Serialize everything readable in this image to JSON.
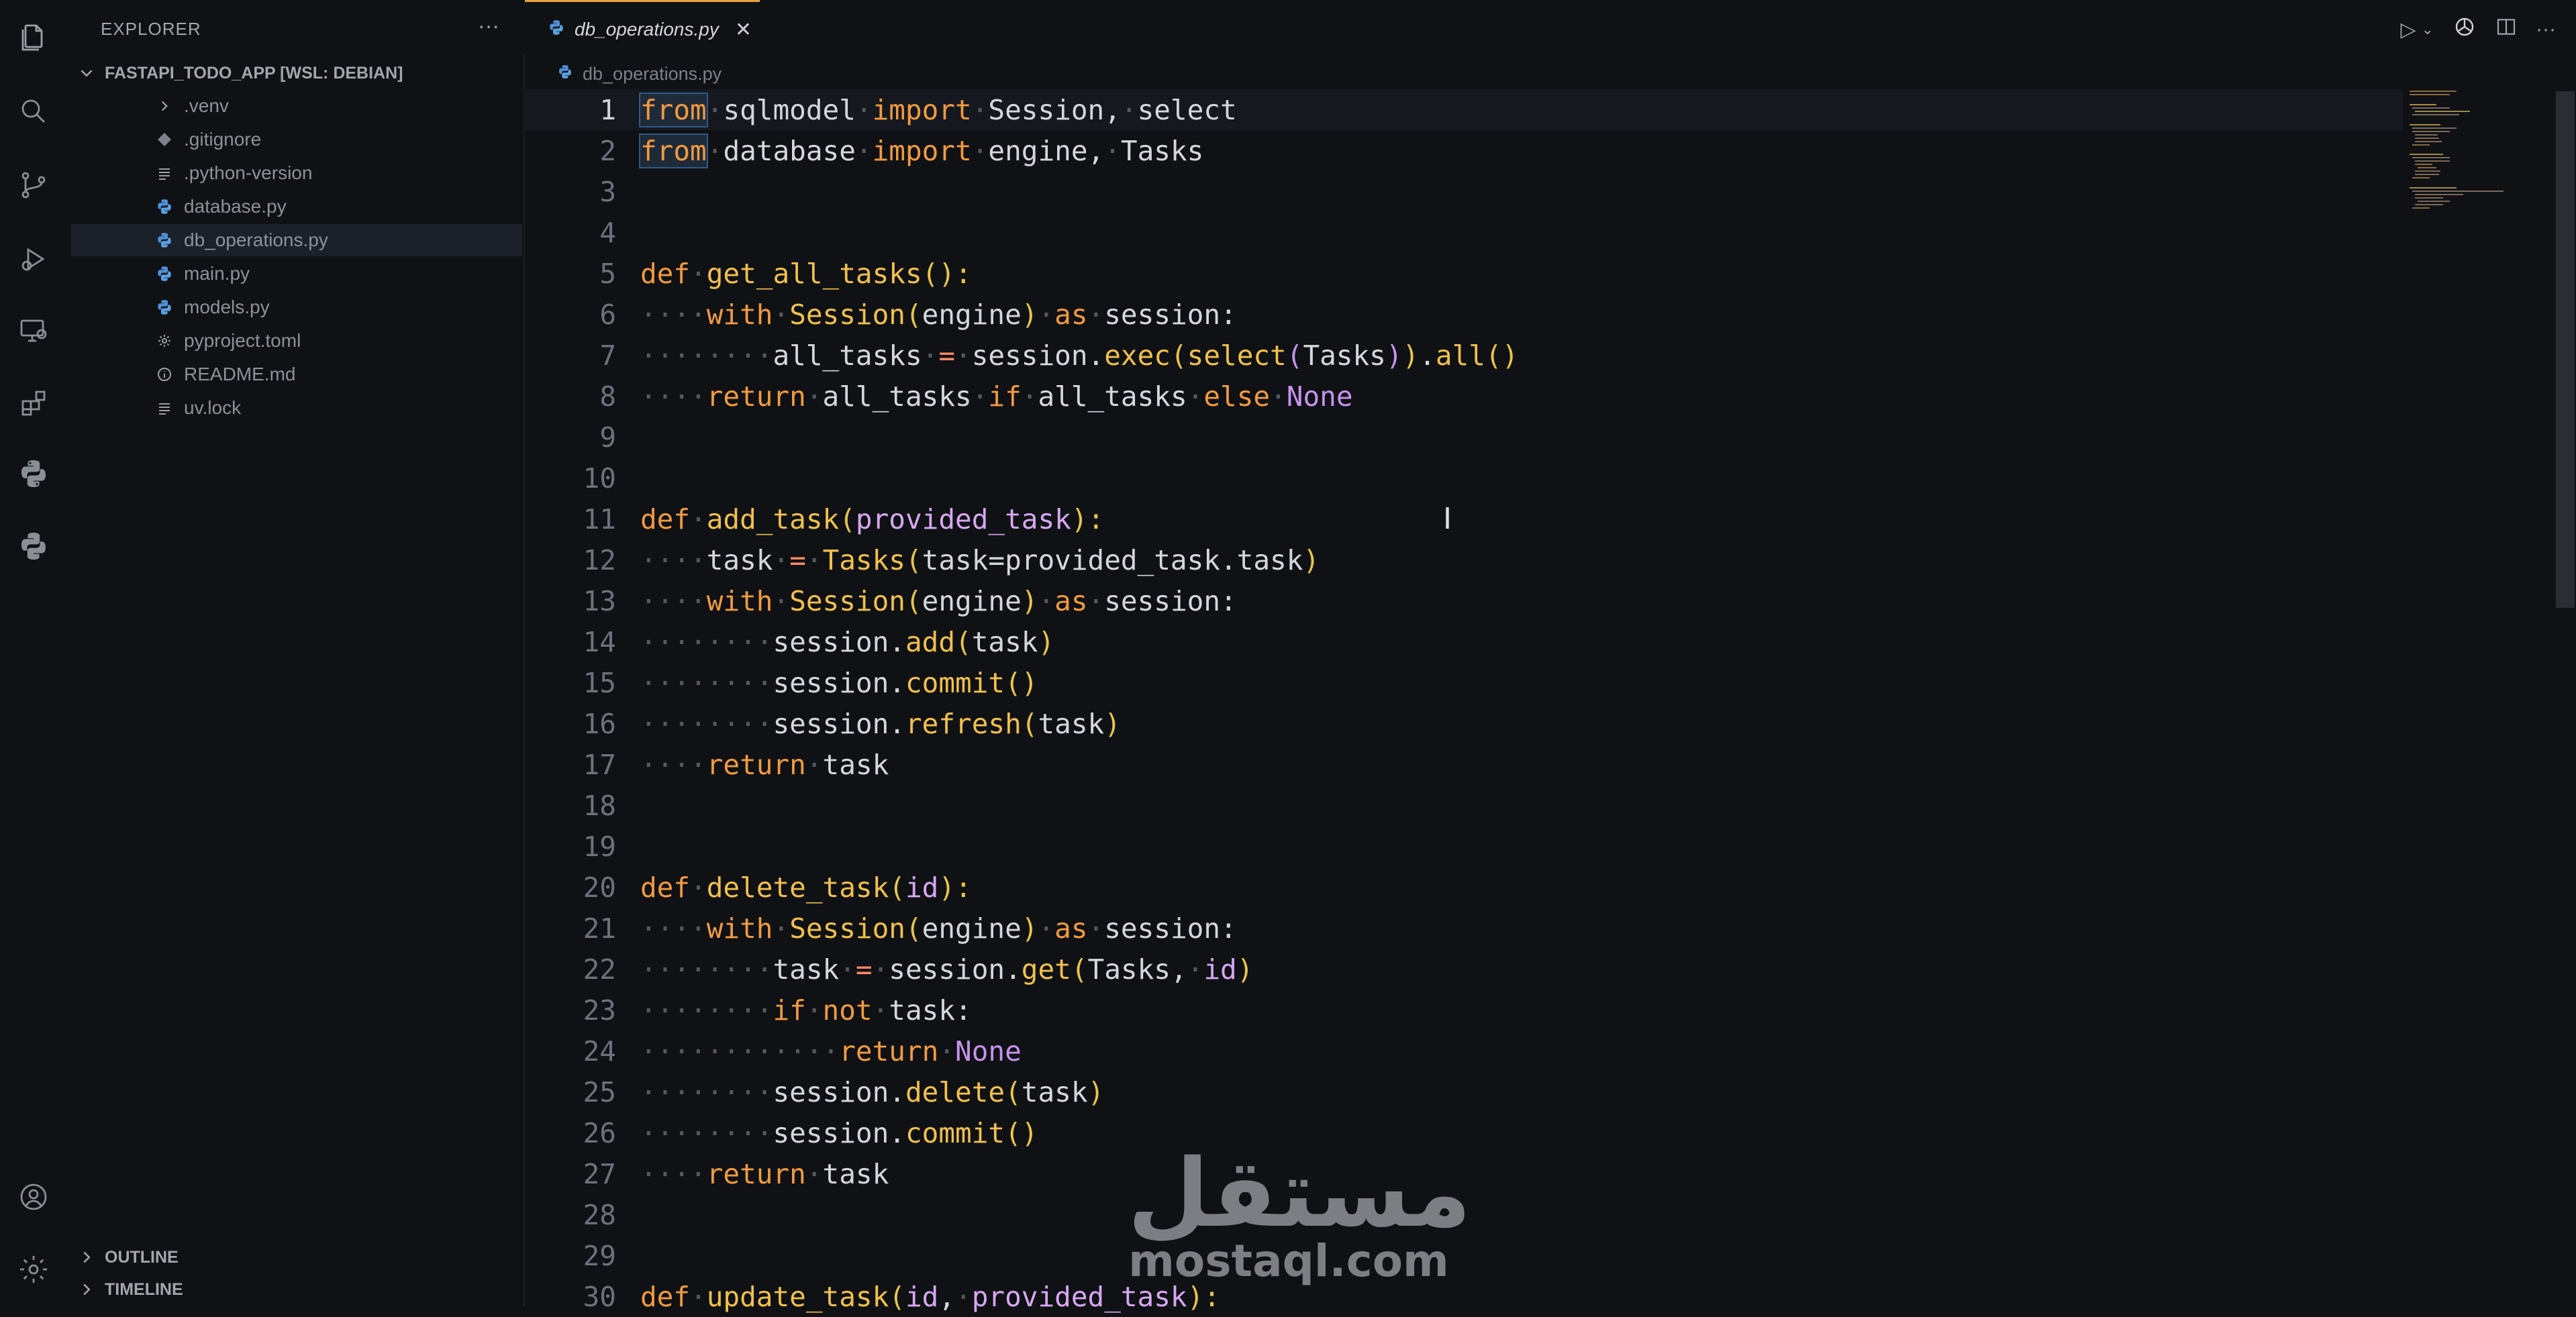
{
  "sidebar": {
    "header": "EXPLORER",
    "project": "FASTAPI_TODO_APP [WSL: DEBIAN]",
    "files": [
      {
        "name": ".venv",
        "icon": "chevron-right-icon"
      },
      {
        "name": ".gitignore",
        "icon": "git-icon"
      },
      {
        "name": ".python-version",
        "icon": "lines-icon"
      },
      {
        "name": "database.py",
        "icon": "python-icon"
      },
      {
        "name": "db_operations.py",
        "icon": "python-icon",
        "selected": true
      },
      {
        "name": "main.py",
        "icon": "python-icon"
      },
      {
        "name": "models.py",
        "icon": "python-icon"
      },
      {
        "name": "pyproject.toml",
        "icon": "gear-icon"
      },
      {
        "name": "README.md",
        "icon": "info-icon"
      },
      {
        "name": "uv.lock",
        "icon": "lines-icon"
      }
    ],
    "outline": "OUTLINE",
    "timeline": "TIMELINE"
  },
  "tab": {
    "label": "db_operations.py",
    "close": "✕"
  },
  "breadcrumb": {
    "file": "db_operations.py"
  },
  "line_numbers": [
    "1",
    "2",
    "3",
    "4",
    "5",
    "6",
    "7",
    "8",
    "9",
    "10",
    "11",
    "12",
    "13",
    "14",
    "15",
    "16",
    "17",
    "18",
    "19",
    "20",
    "21",
    "22",
    "23",
    "24",
    "25",
    "26",
    "27",
    "28",
    "29",
    "30"
  ],
  "watermark": {
    "logo": "مستقل",
    "url": "mostaql.com"
  },
  "colors": {
    "accent": "#e8a33d",
    "background": "#0f1115",
    "keyword": "#f29a3f",
    "function": "#f2c04c",
    "parameter": "#d7a7f0"
  }
}
